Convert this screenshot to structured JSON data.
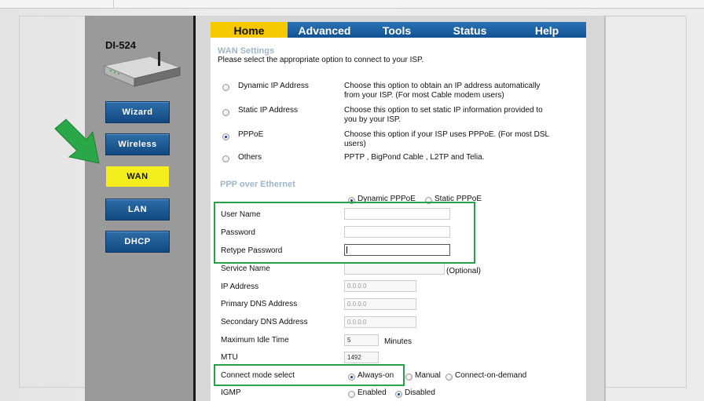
{
  "device": {
    "model": "DI-524"
  },
  "sidebar": {
    "items": [
      {
        "label": "Wizard",
        "active": false
      },
      {
        "label": "Wireless",
        "active": false
      },
      {
        "label": "WAN",
        "active": true
      },
      {
        "label": "LAN",
        "active": false
      },
      {
        "label": "DHCP",
        "active": false
      }
    ]
  },
  "tabs": [
    {
      "label": "Home",
      "active": true
    },
    {
      "label": "Advanced",
      "active": false
    },
    {
      "label": "Tools",
      "active": false
    },
    {
      "label": "Status",
      "active": false
    },
    {
      "label": "Help",
      "active": false
    }
  ],
  "wan": {
    "title": "WAN Settings",
    "instruction": "Please select the appropriate option to connect to your ISP.",
    "options": [
      {
        "label": "Dynamic IP Address",
        "desc1": "Choose this option to obtain an IP address automatically",
        "desc2": "from your ISP. (For most Cable modem users)",
        "selected": false
      },
      {
        "label": "Static IP Address",
        "desc1": "Choose this option to set static IP information provided to",
        "desc2": "you by your ISP.",
        "selected": false
      },
      {
        "label": "PPPoE",
        "desc1": "Choose this option if your ISP uses PPPoE. (For most DSL",
        "desc2": "users)",
        "selected": true
      },
      {
        "label": "Others",
        "desc1": "PPTP , BigPond Cable , L2TP and Telia.",
        "desc2": "",
        "selected": false
      }
    ]
  },
  "pppoe": {
    "title": "PPP over Ethernet",
    "mode_dynamic": "Dynamic PPPoE",
    "mode_static": "Static PPPoE",
    "mode_selected": "Dynamic PPPoE",
    "user_name_label": "User Name",
    "user_name_value": "",
    "password_label": "Password",
    "password_value": "",
    "retype_label": "Retype Password",
    "retype_value": "",
    "service_name_label": "Service Name",
    "service_name_value": "",
    "service_name_hint": "(Optional)",
    "ip_label": "IP Address",
    "ip_value": "0.0.0.0",
    "primary_dns_label": "Primary DNS Address",
    "primary_dns_value": "0.0.0.0",
    "secondary_dns_label": "Secondary DNS Address",
    "secondary_dns_value": "0.0.0.0",
    "idle_label": "Maximum Idle Time",
    "idle_value": "5",
    "idle_unit": "Minutes",
    "mtu_label": "MTU",
    "mtu_value": "1492",
    "connect_label": "Connect mode select",
    "connect_always": "Always-on",
    "connect_manual": "Manual",
    "connect_demand": "Connect-on-demand",
    "connect_selected": "Always-on",
    "igmp_label": "IGMP",
    "igmp_enabled": "Enabled",
    "igmp_disabled": "Disabled",
    "igmp_selected": "Disabled"
  },
  "colors": {
    "nav_blue": "#1a5a95",
    "active_yellow": "#f4ef1c",
    "tab_yellow": "#f5c800",
    "highlight_green": "#27a24a",
    "arrow_green": "#2aa847"
  },
  "icons": [
    "router-image",
    "green-arrow-icon"
  ]
}
